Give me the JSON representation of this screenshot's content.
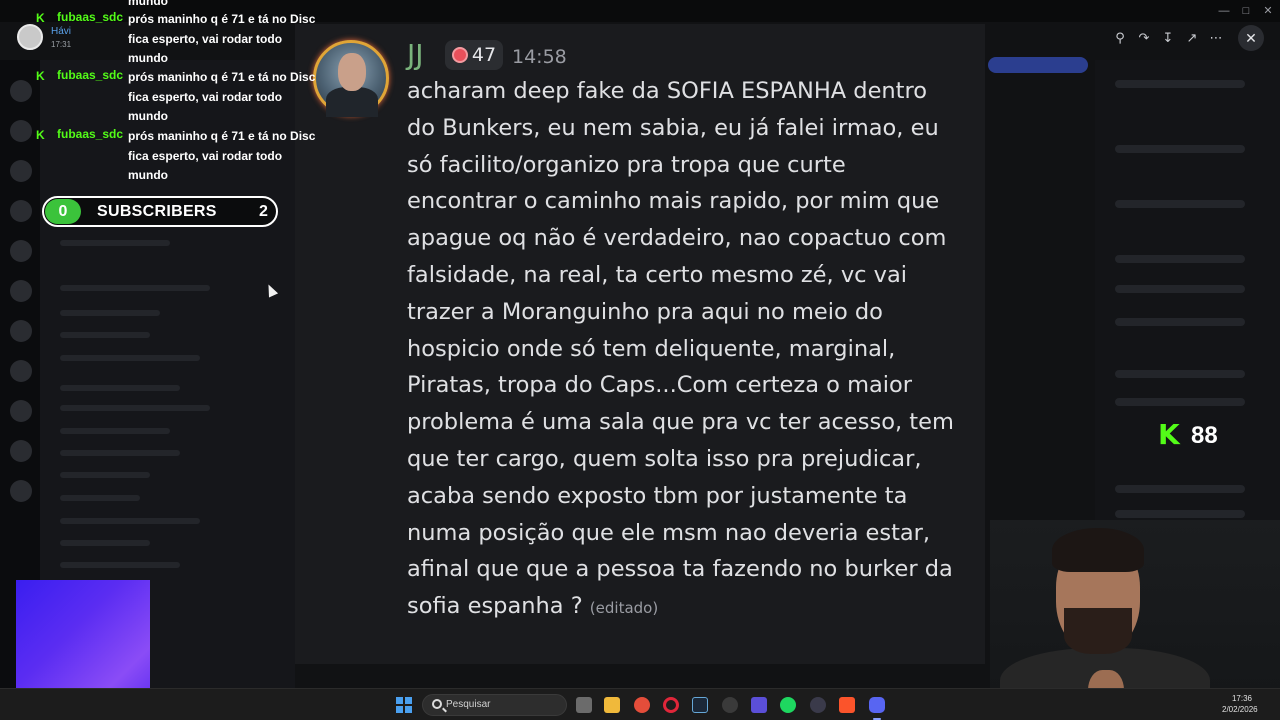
{
  "stream_chat": {
    "subscriber_name": "Hávi",
    "subscriber_time": "17:31",
    "top_fragment": "mundo",
    "messages": [
      {
        "user": "fubaas_sdc",
        "text": "prós maninho q é 71 e tá no Disc fica esperto, vai rodar todo mundo"
      },
      {
        "user": "fubaas_sdc",
        "text": "prós maninho q é 71 e tá no Disc fica esperto, vai rodar todo mundo"
      },
      {
        "user": "fubaas_sdc",
        "text": "prós maninho q é 71 e tá no Disc fica esperto, vai rodar todo mundo"
      }
    ]
  },
  "subscribers_widget": {
    "left_count": "0",
    "label": "SUBSCRIBERS",
    "right_count": "2"
  },
  "kick_viewers": {
    "count": "88",
    "icon": "kick-logo-icon"
  },
  "discord_message": {
    "username": "JJ",
    "badge_count": "47",
    "badge_icon": "heart-badge-icon",
    "timestamp": "14:58",
    "text": "acharam deep fake da SOFIA ESPANHA dentro do Bunkers, eu nem sabia, eu já falei irmao, eu só facilito/organizo pra tropa que curte encontrar o caminho mais rapido, por mim que apague oq não é verdadeiro, nao copactuo com falsidade, na real, ta certo mesmo zé, vc vai trazer a Moranguinho pra aqui no meio do hospicio onde só tem deliquente, marginal, Piratas, tropa do Caps...Com certeza o maior problema é uma sala que pra vc ter acesso, tem que ter cargo, quem solta isso pra prejudicar, acaba sendo exposto tbm por justamente ta numa posição que ele msm nao deveria estar, afinal que que a pessoa ta fazendo no burker da sofia espanha ?",
    "edited_label": "(editado)"
  },
  "taskbar": {
    "search_placeholder": "Pesquisar",
    "time": "17:36",
    "date": "2/02/2026"
  },
  "colors": {
    "kick_green": "#53fc18",
    "username_green": "#7ab37c",
    "subs_green": "#3bc33b",
    "purple": "#5b2df2"
  }
}
